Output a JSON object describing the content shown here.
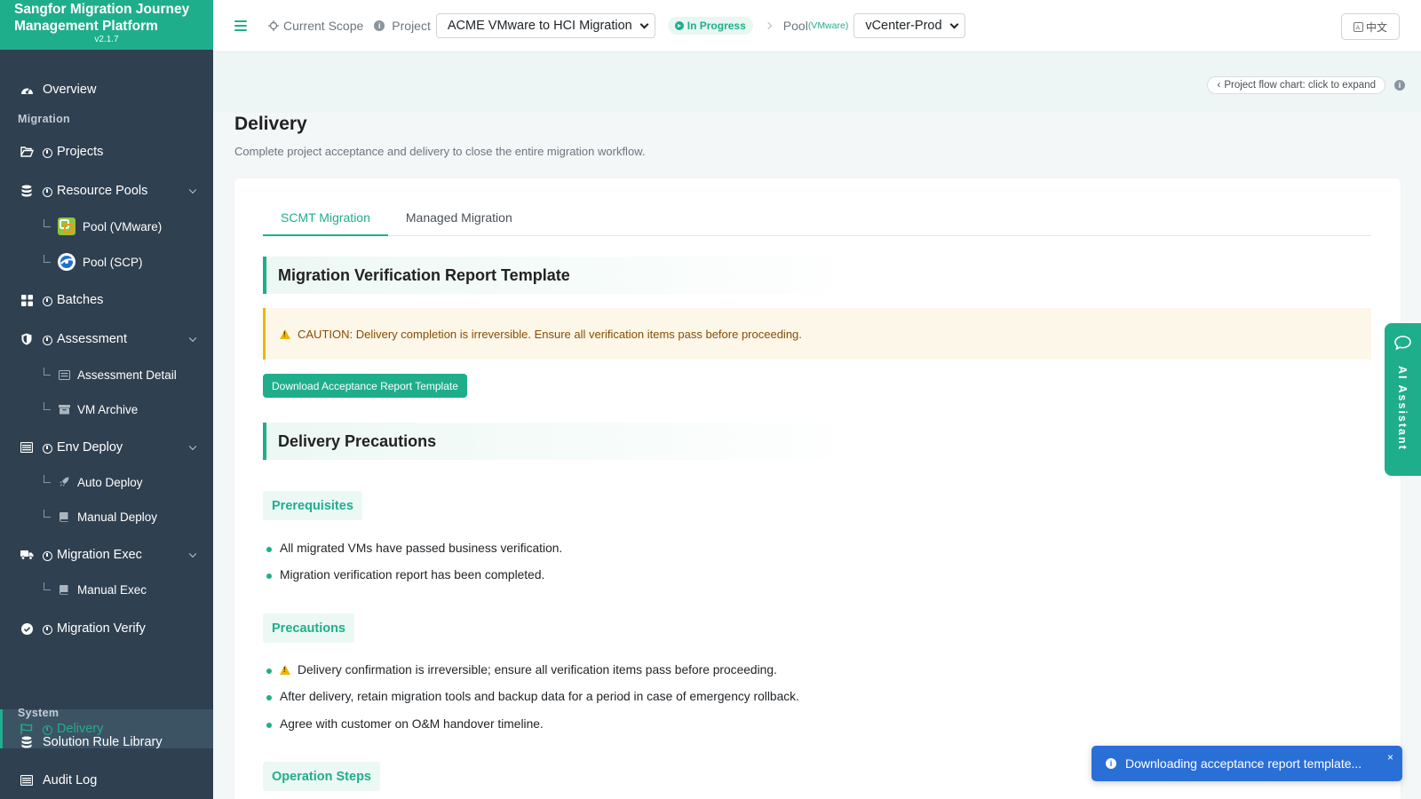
{
  "brand": {
    "title_line1": "Sangfor Migration Journey",
    "title_line2": "Management Platform",
    "version": "v2.1.7"
  },
  "sidebar": {
    "overview": "Overview",
    "section_migration": "Migration",
    "projects": "Projects",
    "resource_pools": "Resource Pools",
    "pool_vmware": "Pool (VMware)",
    "pool_scp": "Pool (SCP)",
    "batches": "Batches",
    "assessment": "Assessment",
    "assessment_detail": "Assessment Detail",
    "vm_archive": "VM Archive",
    "env_deploy": "Env Deploy",
    "auto_deploy": "Auto Deploy",
    "manual_deploy": "Manual Deploy",
    "migration_exec": "Migration Exec",
    "manual_exec": "Manual Exec",
    "migration_verify": "Migration Verify",
    "delivery": "Delivery",
    "section_system": "System",
    "solution_rule_library": "Solution Rule Library",
    "audit_log": "Audit Log"
  },
  "topbar": {
    "current_scope": "Current Scope",
    "project_label": "Project",
    "project_value": "ACME VMware to HCI Migration",
    "status": "In Progress",
    "pool_label": "Pool",
    "pool_type": "(VMware)",
    "pool_value": "vCenter-Prod",
    "lang": "中文"
  },
  "flowbar": {
    "button": "Project flow chart: click to expand"
  },
  "page": {
    "title": "Delivery",
    "description": "Complete project acceptance and delivery to close the entire migration workflow."
  },
  "tabs": [
    "SCMT Migration",
    "Managed Migration"
  ],
  "content": {
    "report_title": "Migration Verification Report Template",
    "caution": "CAUTION: Delivery completion is irreversible. Ensure all verification items pass before proceeding.",
    "download_button": "Download Acceptance Report Template",
    "precautions_title": "Delivery Precautions",
    "prerequisites_head": "Prerequisites",
    "prerequisites": [
      "All migrated VMs have passed business verification.",
      "Migration verification report has been completed."
    ],
    "precautions_head": "Precautions",
    "precautions": [
      "Delivery confirmation is irreversible; ensure all verification items pass before proceeding.",
      "After delivery, retain migration tools and backup data for a period in case of emergency rollback.",
      "Agree with customer on O&M handover timeline."
    ],
    "steps_head": "Operation Steps"
  },
  "ai_assistant": "AI Assistant",
  "toast": {
    "message": "Downloading acceptance report template...",
    "close": "×"
  },
  "colors": {
    "accent": "#1fae8c",
    "sidebar_bg": "#2f4050",
    "toast_bg": "#2a6fd6",
    "caution_bg": "#fdf7e9"
  }
}
